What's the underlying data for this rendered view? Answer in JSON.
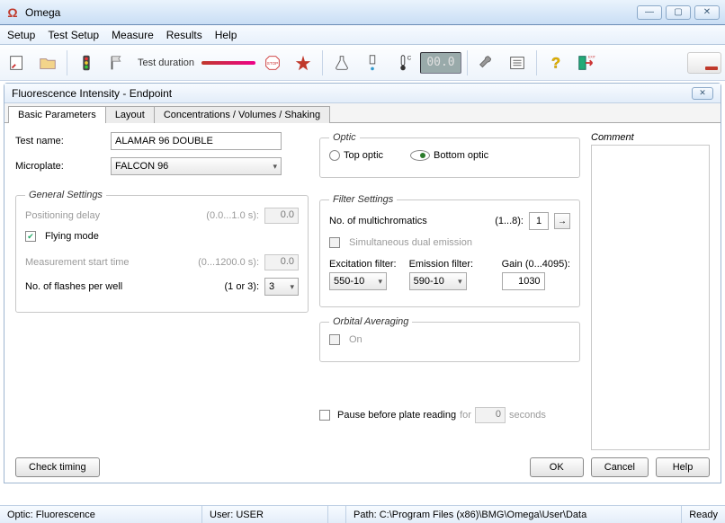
{
  "window": {
    "title": "Omega",
    "logo": "Ω"
  },
  "menubar": [
    "Setup",
    "Test Setup",
    "Measure",
    "Results",
    "Help"
  ],
  "toolbar": {
    "test_duration": "Test duration",
    "lcd": "00.0"
  },
  "subwin": {
    "title": "Fluorescence Intensity  -  Endpoint"
  },
  "tabs": [
    "Basic Parameters",
    "Layout",
    "Concentrations / Volumes / Shaking"
  ],
  "form": {
    "test_name_lbl": "Test name:",
    "test_name_val": "ALAMAR 96 DOUBLE",
    "microplate_lbl": "Microplate:",
    "microplate_val": "FALCON 96",
    "general_legend": "General Settings",
    "pos_delay_lbl": "Positioning delay",
    "pos_delay_range": "(0.0...1.0 s):",
    "pos_delay_val": "0.0",
    "flying_mode": "Flying mode",
    "meas_start_lbl": "Measurement start time",
    "meas_start_range": "(0...1200.0 s):",
    "meas_start_val": "0.0",
    "flashes_lbl": "No. of flashes per well",
    "flashes_range": "(1 or 3):",
    "flashes_val": "3",
    "optic_legend": "Optic",
    "top_optic": "Top optic",
    "bottom_optic": "Bottom optic",
    "filter_legend": "Filter Settings",
    "multichrom_lbl": "No. of multichromatics",
    "multichrom_range": "(1...8):",
    "multichrom_val": "1",
    "sim_dual": "Simultaneous dual emission",
    "exc_lbl": "Excitation filter:",
    "exc_val": "550-10",
    "emi_lbl": "Emission filter:",
    "emi_val": "590-10",
    "gain_lbl": "Gain (0...4095):",
    "gain_val": "1030",
    "orbital_legend": "Orbital Averaging",
    "orbital_on": "On",
    "pause_lbl": "Pause before plate reading",
    "pause_for": "for",
    "pause_val": "0",
    "pause_unit": "seconds",
    "comment_legend": "Comment"
  },
  "buttons": {
    "check_timing": "Check timing",
    "ok": "OK",
    "cancel": "Cancel",
    "help": "Help"
  },
  "status": {
    "optic": "Optic: Fluorescence",
    "user": "User: USER",
    "path": "Path: C:\\Program Files (x86)\\BMG\\Omega\\User\\Data",
    "ready": "Ready"
  }
}
